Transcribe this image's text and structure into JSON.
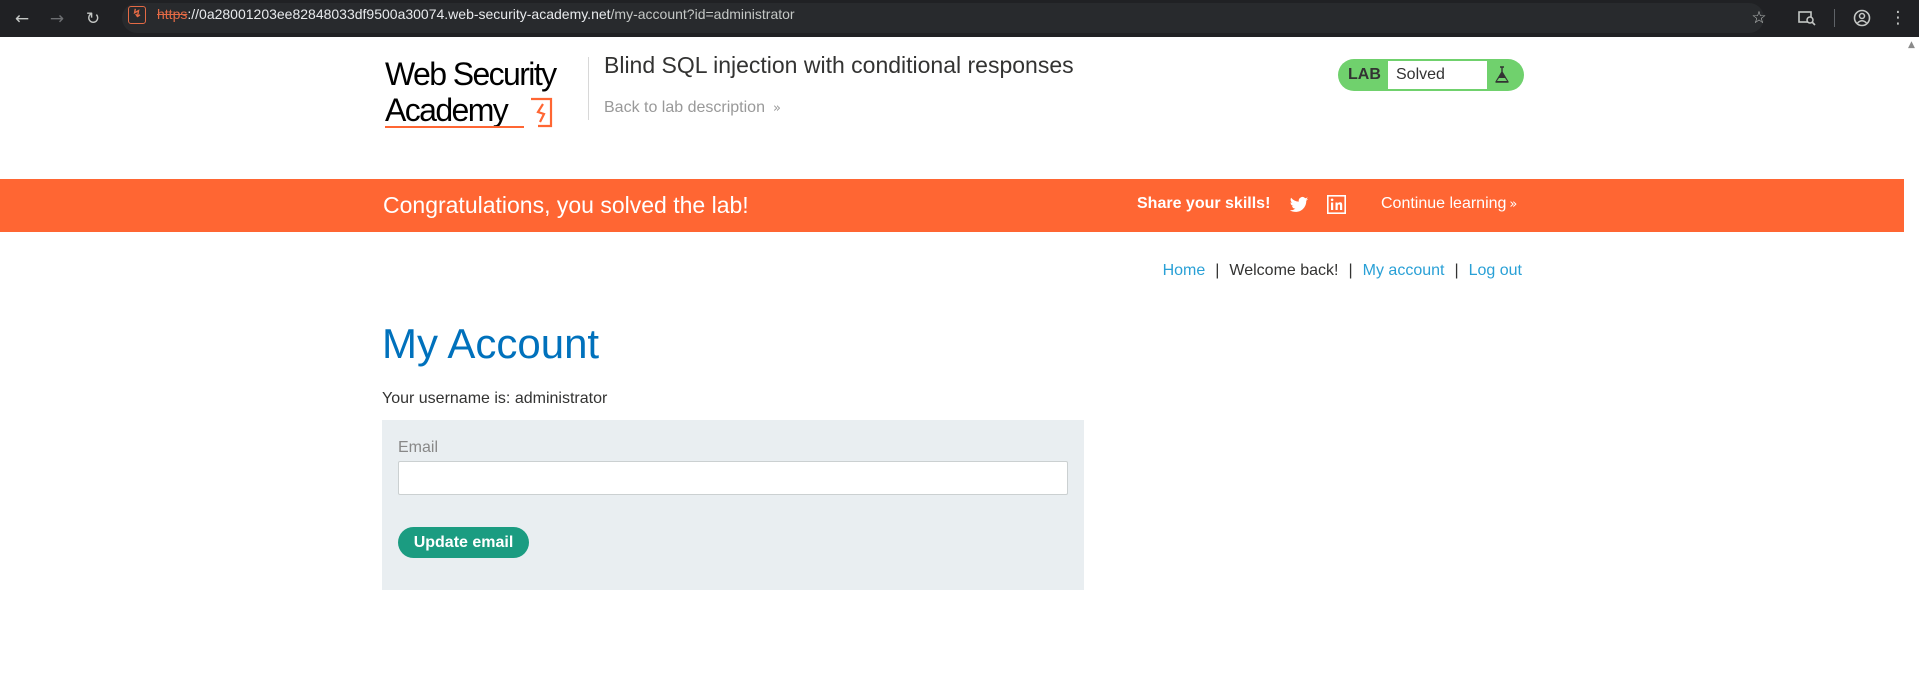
{
  "browser": {
    "url_scheme": "https",
    "url_host": "://0a28001203ee82848033df9500a30074.web-security-academy.net",
    "url_path": "/my-account?id=administrator",
    "icons": [
      "back-arrow-icon",
      "forward-arrow-icon",
      "reload-icon",
      "site-info-icon",
      "bookmark-star-icon",
      "tab-search-icon",
      "profile-icon",
      "more-menu-icon"
    ]
  },
  "header": {
    "logo_line1": "Web Security",
    "logo_line2": "Academy",
    "lab_title": "Blind SQL injection with conditional responses",
    "back_link": "Back to lab description",
    "status_label": "LAB",
    "status_value": "Solved"
  },
  "banner": {
    "message": "Congratulations, you solved the lab!",
    "share_label": "Share your skills!",
    "continue_label": "Continue learning"
  },
  "nav": {
    "home": "Home",
    "welcome": "Welcome back!",
    "my_account": "My account",
    "log_out": "Log out",
    "separator": "|"
  },
  "main": {
    "title": "My Account",
    "username_line": "Your username is: administrator",
    "email_label": "Email",
    "email_value": "",
    "update_button": "Update email"
  },
  "colors": {
    "accent_orange": "#ff6633",
    "title_blue": "#0071bc",
    "link_blue": "#29a0d6",
    "button_green": "#1b9c81",
    "status_green": "#70d16d"
  }
}
